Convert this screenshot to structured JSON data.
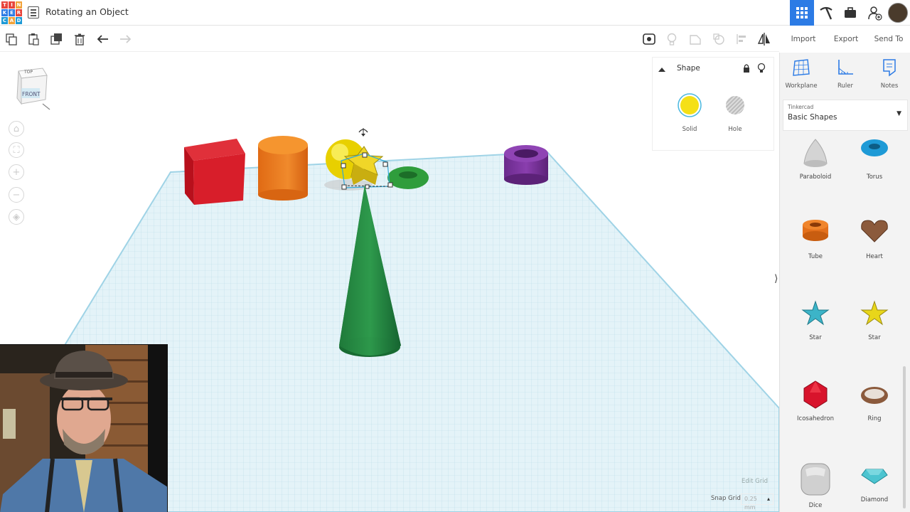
{
  "app": {
    "logo_letters": [
      "T",
      "I",
      "N",
      "K",
      "E",
      "R",
      "C",
      "A",
      "D"
    ],
    "logo_colors": [
      "#e8453c",
      "#e8453c",
      "#f2a33a",
      "#2c7be5",
      "#2c7be5",
      "#e8453c",
      "#1e9ad6",
      "#f2a33a",
      "#1e9ad6"
    ],
    "title": "Rotating an Object",
    "accent": "#2c7be5"
  },
  "top_actions": {
    "icons": [
      "grid-icon",
      "pickaxe-icon",
      "briefcase-icon",
      "add-user-icon",
      "avatar"
    ]
  },
  "toolbar": {
    "left_icons": [
      "copy-icon",
      "paste-icon",
      "duplicate-icon",
      "delete-icon",
      "undo-icon",
      "redo-icon"
    ],
    "right_icons": [
      "notes-visibility-icon",
      "lightbulb-icon",
      "group-icon",
      "ungroup-icon",
      "align-icon",
      "mirror-icon"
    ],
    "import_label": "Import",
    "export_label": "Export",
    "send_to_label": "Send To"
  },
  "viewcube": {
    "top_label": "TOP",
    "front_label": "FRONT"
  },
  "nav_buttons": [
    "home-icon",
    "fit-icon",
    "zoom-in-icon",
    "zoom-out-icon",
    "perspective-icon"
  ],
  "inspector": {
    "title": "Shape",
    "solid_label": "Solid",
    "hole_label": "Hole",
    "solid_color": "#f5e017"
  },
  "grid": {
    "edit_label": "Edit Grid",
    "snap_label": "Snap Grid",
    "snap_value": "0.25",
    "snap_unit": "mm"
  },
  "panel": {
    "workplane_label": "Workplane",
    "ruler_label": "Ruler",
    "notes_label": "Notes",
    "library_owner": "Tinkercad",
    "library_name": "Basic Shapes",
    "shapes": [
      {
        "label": "Paraboloid",
        "icon": "paraboloid-icon",
        "color": "#cfcfcf"
      },
      {
        "label": "Torus",
        "icon": "torus-icon",
        "color": "#1e9ad6"
      },
      {
        "label": "Tube",
        "icon": "tube-icon",
        "color": "#e3701c"
      },
      {
        "label": "Heart",
        "icon": "heart-icon",
        "color": "#8b5a3c"
      },
      {
        "label": "Star",
        "icon": "star-icon",
        "color": "#3cb4c8"
      },
      {
        "label": "Star",
        "icon": "star-icon",
        "color": "#e8d61a"
      },
      {
        "label": "Icosahedron",
        "icon": "icosahedron-icon",
        "color": "#d8142c"
      },
      {
        "label": "Ring",
        "icon": "ring-icon",
        "color": "#8b5a3c"
      },
      {
        "label": "Dice",
        "icon": "dice-icon",
        "color": "#cfcfcf"
      },
      {
        "label": "Diamond",
        "icon": "diamond-icon",
        "color": "#4cc4d0"
      }
    ]
  }
}
